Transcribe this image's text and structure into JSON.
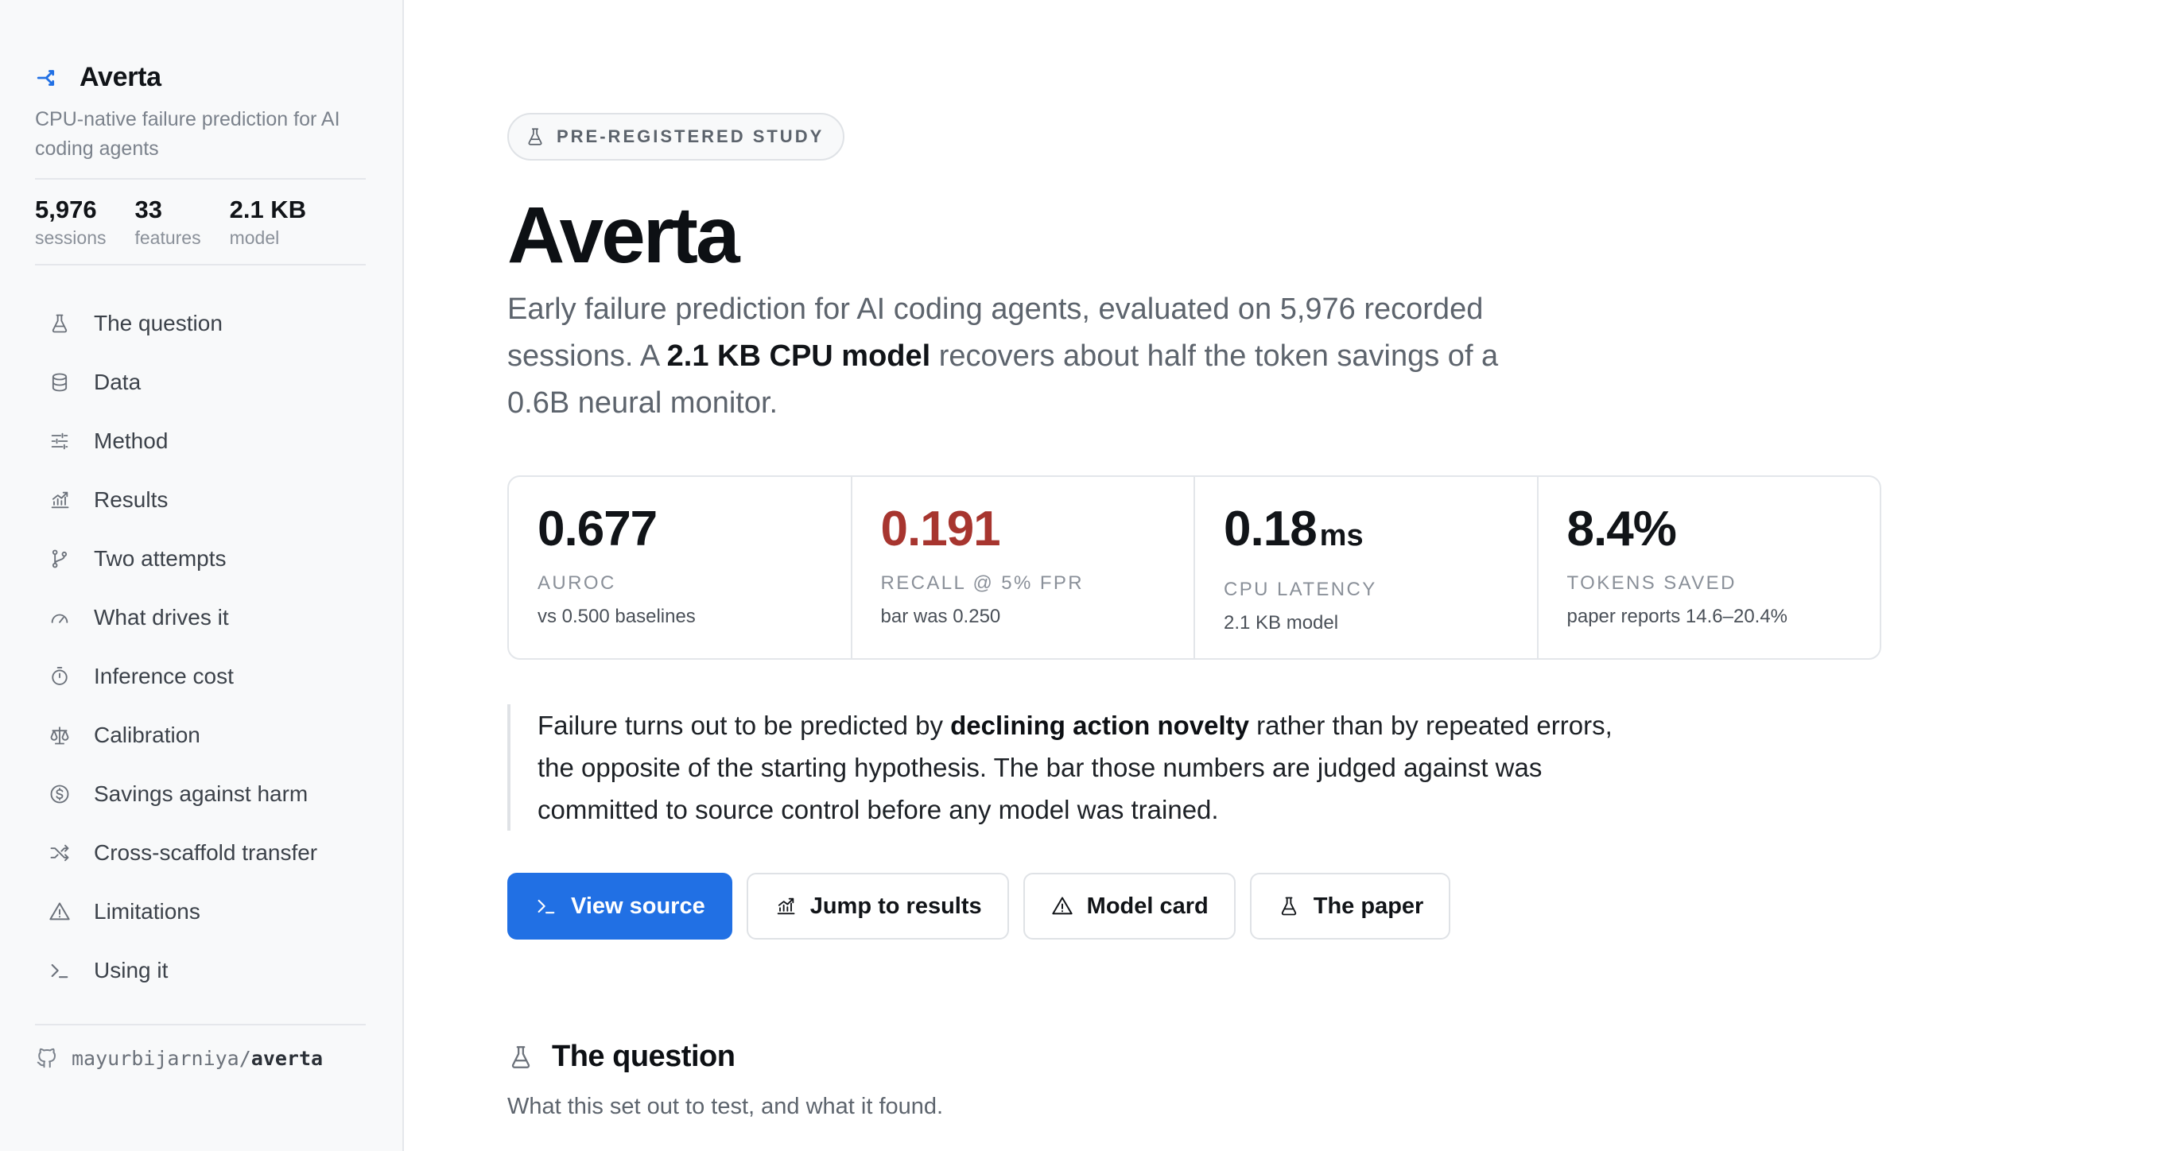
{
  "brand": {
    "name": "Averta",
    "tagline": "CPU-native failure prediction for AI coding agents",
    "icon": "arrow-split-icon",
    "accent": "#2170e4"
  },
  "stats": [
    {
      "value": "5,976",
      "label": "sessions"
    },
    {
      "value": "33",
      "label": "features"
    },
    {
      "value": "2.1 KB",
      "label": "model"
    }
  ],
  "nav": [
    {
      "label": "The question",
      "icon": "flask-icon"
    },
    {
      "label": "Data",
      "icon": "database-icon"
    },
    {
      "label": "Method",
      "icon": "sliders-icon"
    },
    {
      "label": "Results",
      "icon": "chart-icon"
    },
    {
      "label": "Two attempts",
      "icon": "git-branch-icon"
    },
    {
      "label": "What drives it",
      "icon": "gauge-icon"
    },
    {
      "label": "Inference cost",
      "icon": "timer-icon"
    },
    {
      "label": "Calibration",
      "icon": "scale-icon"
    },
    {
      "label": "Savings against harm",
      "icon": "dollar-icon"
    },
    {
      "label": "Cross-scaffold transfer",
      "icon": "shuffle-icon"
    },
    {
      "label": "Limitations",
      "icon": "warning-icon"
    },
    {
      "label": "Using it",
      "icon": "terminal-icon"
    }
  ],
  "repo": {
    "owner": "mayurbijarniya/",
    "name": "averta",
    "icon": "github-icon"
  },
  "hero": {
    "badge": "PRE-REGISTERED STUDY",
    "title": "Averta",
    "lede_1": "Early failure prediction for AI coding agents, evaluated on 5,976 recorded sessions. A ",
    "lede_bold": "2.1 KB CPU model",
    "lede_2": " recovers about half the token savings of a 0.6B neural monitor."
  },
  "metrics": [
    {
      "value": "0.677",
      "unit": "",
      "label": "AUROC",
      "sub": "vs 0.500 baselines",
      "color": "#111418"
    },
    {
      "value": "0.191",
      "unit": "",
      "label": "RECALL @ 5% FPR",
      "sub": "bar was 0.250",
      "color": "#a7352f"
    },
    {
      "value": "0.18",
      "unit": "ms",
      "label": "CPU LATENCY",
      "sub": "2.1 KB model",
      "color": "#111418"
    },
    {
      "value": "8.4%",
      "unit": "",
      "label": "TOKENS SAVED",
      "sub": "paper reports 14.6–20.4%",
      "color": "#111418"
    }
  ],
  "quote": {
    "part_1": "Failure turns out to be predicted by ",
    "bold": "declining action novelty",
    "part_2": " rather than by repeated errors, the opposite of the starting hypothesis. The bar those numbers are judged against was committed to source control before any model was trained."
  },
  "buttons": [
    {
      "label": "View source",
      "icon": "terminal-icon"
    },
    {
      "label": "Jump to results",
      "icon": "chart-icon"
    },
    {
      "label": "Model card",
      "icon": "warning-icon"
    },
    {
      "label": "The paper",
      "icon": "flask-icon"
    }
  ],
  "section": {
    "title": "The question",
    "subtitle": "What this set out to test, and what it found.",
    "icon": "flask-icon"
  }
}
